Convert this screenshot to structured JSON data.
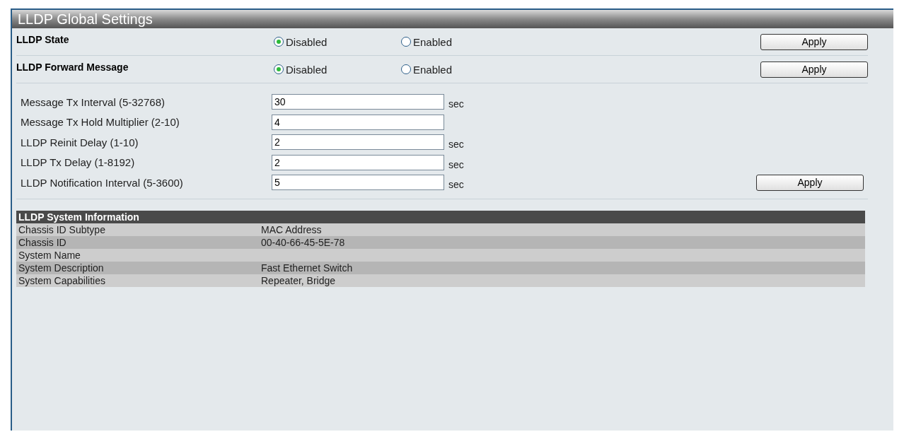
{
  "panel": {
    "title": "LLDP Global Settings"
  },
  "radio_settings": [
    {
      "label": "LLDP State",
      "options": [
        {
          "label": "Disabled",
          "selected": true
        },
        {
          "label": "Enabled",
          "selected": false
        }
      ],
      "button": "Apply"
    },
    {
      "label": "LLDP Forward Message",
      "options": [
        {
          "label": "Disabled",
          "selected": true
        },
        {
          "label": "Enabled",
          "selected": false
        }
      ],
      "button": "Apply"
    }
  ],
  "fields": [
    {
      "label": "Message Tx Interval (5-32768)",
      "value": "30",
      "unit": "sec"
    },
    {
      "label": "Message Tx Hold Multiplier (2-10)",
      "value": "4"
    },
    {
      "label": "LLDP Reinit Delay (1-10)",
      "value": "2",
      "unit": "sec"
    },
    {
      "label": "LLDP Tx Delay (1-8192)",
      "value": "2",
      "unit": "sec"
    },
    {
      "label": "LLDP Notification Interval (5-3600)",
      "value": "5",
      "unit": "sec"
    }
  ],
  "fields_button": "Apply",
  "info_table": {
    "title": "LLDP System Information",
    "rows": [
      {
        "label": "Chassis ID Subtype",
        "value": "MAC Address"
      },
      {
        "label": "Chassis ID",
        "value": "00-40-66-45-5E-78"
      },
      {
        "label": "System Name",
        "value": ""
      },
      {
        "label": "System Description",
        "value": "Fast Ethernet Switch"
      },
      {
        "label": "System Capabilities",
        "value": "Repeater, Bridge"
      }
    ]
  }
}
